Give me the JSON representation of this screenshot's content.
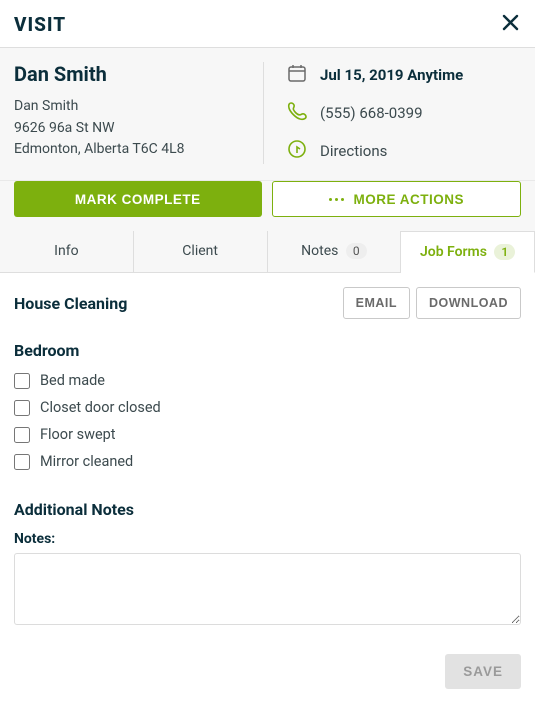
{
  "header": {
    "title": "VISIT"
  },
  "customer": {
    "name": "Dan Smith",
    "contact_name": "Dan Smith",
    "address_line1": "9626 96a St NW",
    "address_line2": "Edmonton, Alberta T6C 4L8"
  },
  "details": {
    "date": "Jul 15, 2019 Anytime",
    "phone": "(555) 668-0399",
    "directions": "Directions"
  },
  "buttons": {
    "complete": "MARK COMPLETE",
    "more": "MORE ACTIONS"
  },
  "tabs": {
    "info": "Info",
    "client": "Client",
    "notes": "Notes",
    "notes_count": "0",
    "job_forms": "Job Forms",
    "job_forms_count": "1"
  },
  "form": {
    "title": "House Cleaning",
    "email_btn": "EMAIL",
    "download_btn": "DOWNLOAD",
    "section_bedroom": "Bedroom",
    "item1": "Bed made",
    "item2": "Closet door closed",
    "item3": "Floor swept",
    "item4": "Mirror cleaned",
    "additional_notes": "Additional Notes",
    "notes_label": "Notes:",
    "save_btn": "SAVE"
  }
}
